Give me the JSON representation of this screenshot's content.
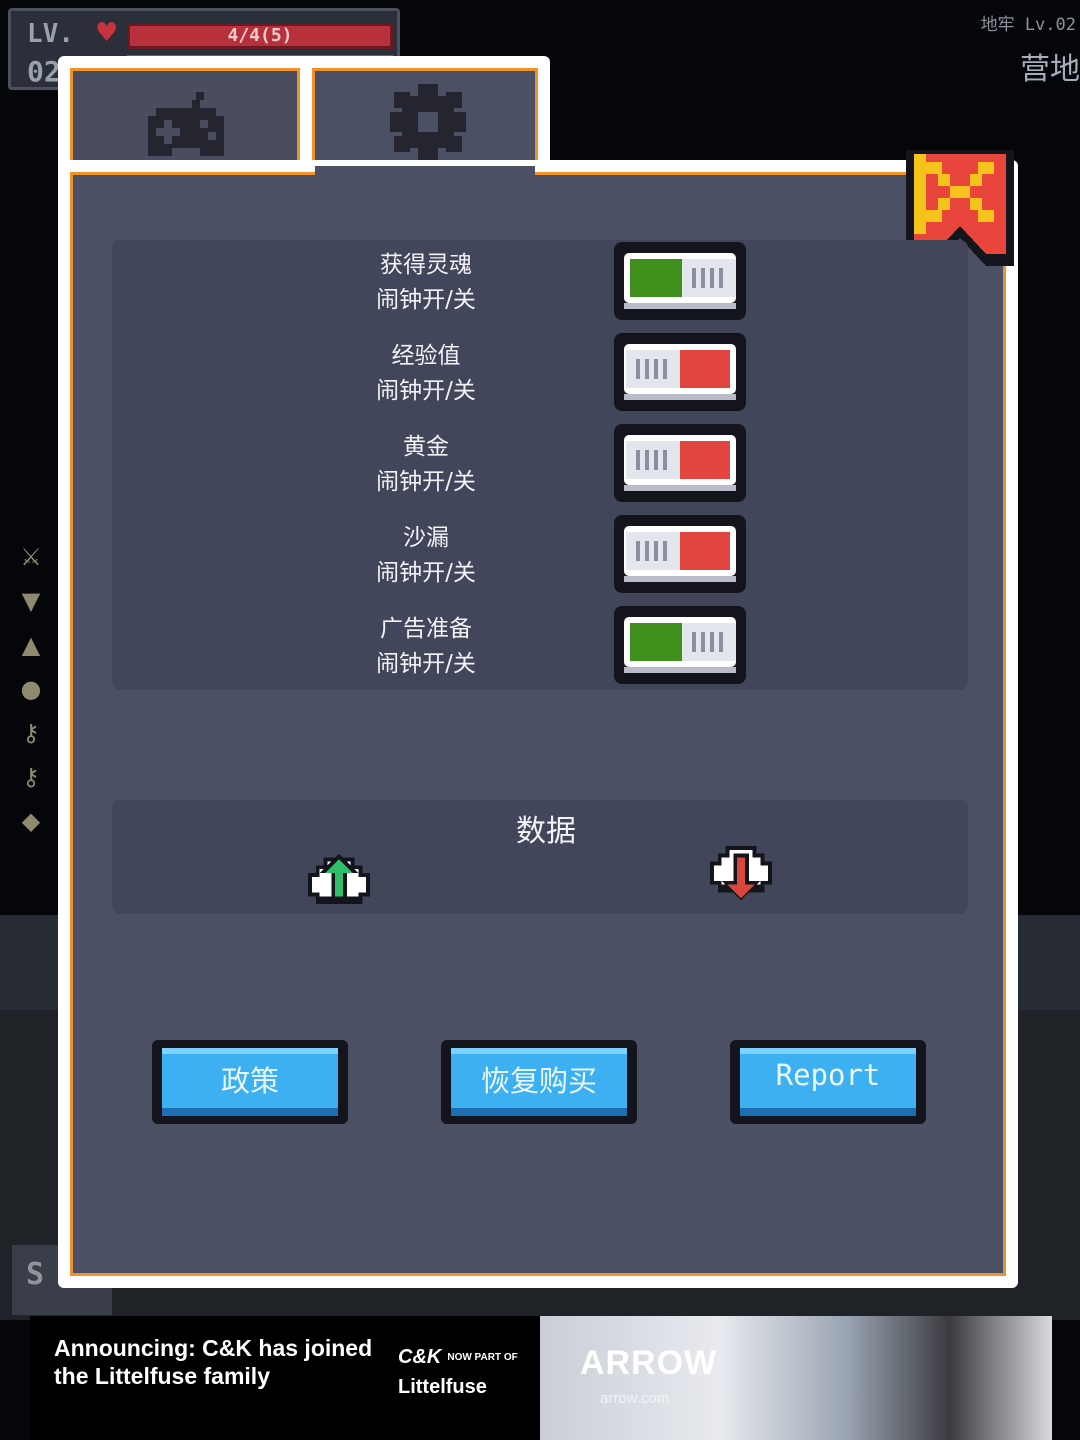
{
  "hud": {
    "level_label": "LV.",
    "level_value": "02",
    "hp_text": "4/4(5)",
    "zone_small": "地牢 Lv.02",
    "zone_big": "营地",
    "bottom_tab": "S"
  },
  "settings": {
    "tabs": [
      {
        "name": "game",
        "icon": "gamepad-icon",
        "active": false
      },
      {
        "name": "settings",
        "icon": "gear-icon",
        "active": true
      }
    ],
    "toggles": [
      {
        "title": "获得灵魂",
        "subtitle": "闹钟开/关",
        "on": true
      },
      {
        "title": "经验值",
        "subtitle": "闹钟开/关",
        "on": false
      },
      {
        "title": "黄金",
        "subtitle": "闹钟开/关",
        "on": false
      },
      {
        "title": "沙漏",
        "subtitle": "闹钟开/关",
        "on": false
      },
      {
        "title": "广告准备",
        "subtitle": "闹钟开/关",
        "on": true
      }
    ],
    "data_section": {
      "title": "数据",
      "upload_icon": "cloud-upload-icon",
      "download_icon": "cloud-download-icon"
    },
    "buttons": {
      "policy": "政策",
      "restore": "恢复购买",
      "report": "Report"
    }
  },
  "ad": {
    "headline": "Announcing: C&K has joined the Littelfuse family",
    "ck_logo": "C&K",
    "ck_tag": "NOW PART OF",
    "littelfuse": "Littelfuse",
    "brand": "ARROW",
    "url": "arrow.com"
  },
  "colors": {
    "panel_bg": "#4b5064",
    "card_bg": "#41465a",
    "border_orange": "#f0922b",
    "toggle_on": "#3e8f1c",
    "toggle_off": "#e2453e",
    "button_blue": "#3cb0f0",
    "close_red": "#e8463c",
    "close_yellow": "#f6c21c"
  }
}
